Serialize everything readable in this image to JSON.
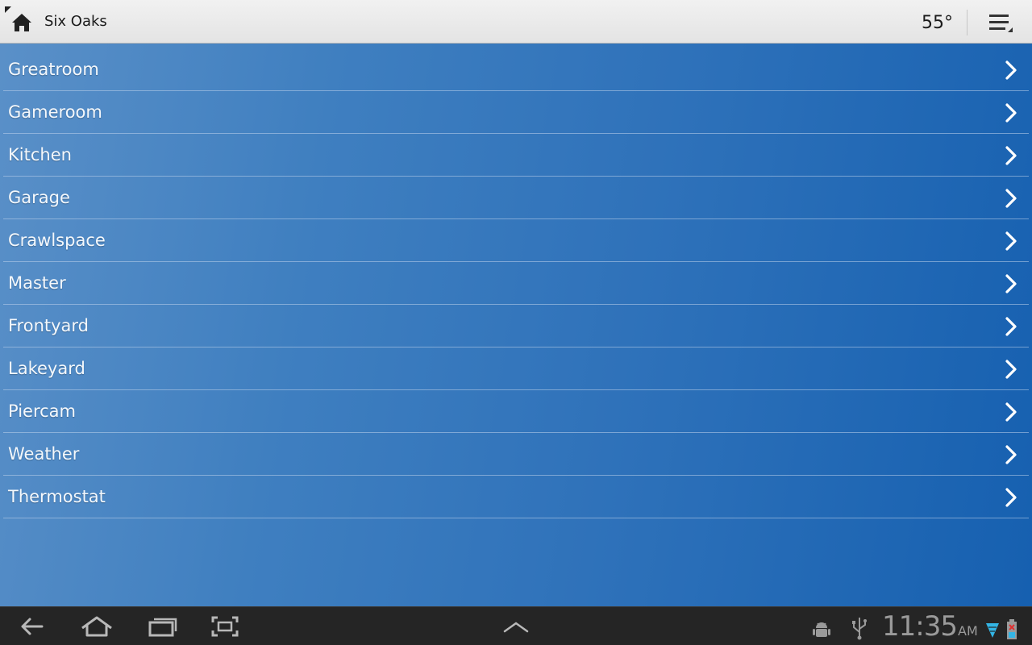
{
  "action_bar": {
    "title": "Six Oaks",
    "temperature": "55°",
    "icons": {
      "home": "home-icon",
      "overflow": "overflow-menu-icon"
    }
  },
  "rooms": [
    {
      "label": "Greatroom"
    },
    {
      "label": "Gameroom"
    },
    {
      "label": "Kitchen"
    },
    {
      "label": "Garage"
    },
    {
      "label": "Crawlspace"
    },
    {
      "label": "Master"
    },
    {
      "label": "Frontyard"
    },
    {
      "label": "Lakeyard"
    },
    {
      "label": "Piercam"
    },
    {
      "label": "Weather"
    },
    {
      "label": "Thermostat"
    }
  ],
  "system_bar": {
    "time": "11:35",
    "ampm": "AM",
    "icons": [
      "back-icon",
      "home-icon",
      "recent-apps-icon",
      "screenshot-icon",
      "menu-up-icon",
      "android-debug-icon",
      "usb-icon",
      "wifi-icon",
      "battery-icon"
    ]
  },
  "colors": {
    "action_bar_bg": "#e8e8e8",
    "list_bg_start": "#5a90c8",
    "list_bg_end": "#1660b0",
    "system_bar_bg": "#252525",
    "wifi": "#33b5e5",
    "battery_alert": "#e03030"
  }
}
